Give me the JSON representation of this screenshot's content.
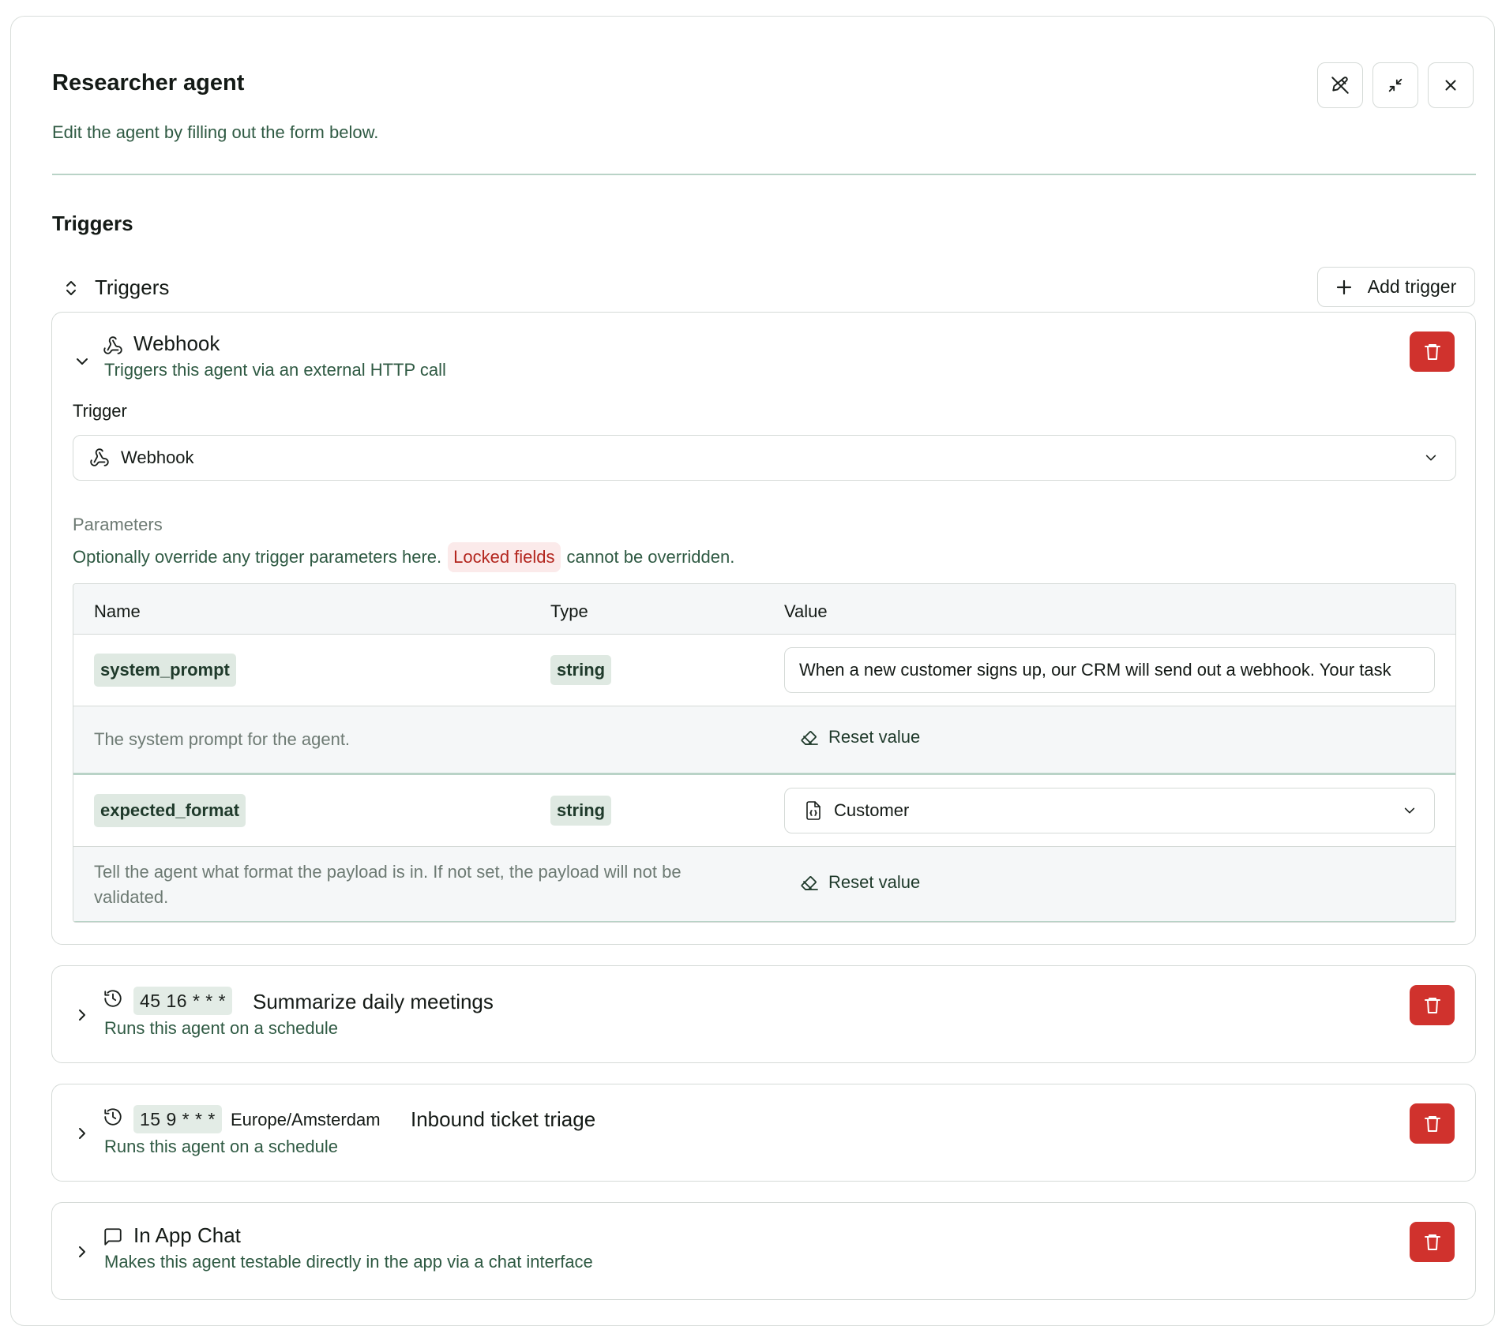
{
  "header": {
    "title": "Researcher agent",
    "subtitle": "Edit the agent by filling out the form below."
  },
  "section": {
    "title": "Triggers"
  },
  "triggers_toolbar": {
    "label": "Triggers",
    "add_label": "Add trigger"
  },
  "webhook_card": {
    "title": "Webhook",
    "description": "Triggers this agent via an external HTTP call",
    "trigger_label": "Trigger",
    "trigger_value": "Webhook",
    "params_label": "Parameters",
    "params_help_prefix": "Optionally override any trigger parameters here.",
    "params_help_locked": "Locked fields",
    "params_help_suffix": "cannot be overridden.",
    "table": {
      "columns": [
        "Name",
        "Type",
        "Value"
      ],
      "rows": [
        {
          "name": "system_prompt",
          "type": "string",
          "value": "When a new customer signs up, our CRM will send out a webhook. Your task",
          "description": "The system prompt for the agent.",
          "reset_label": "Reset value"
        },
        {
          "name": "expected_format",
          "type": "string",
          "value": "Customer",
          "description": "Tell the agent what format the payload is in. If not set, the payload will not be validated.",
          "reset_label": "Reset value"
        }
      ]
    }
  },
  "schedule_cards": [
    {
      "cron": "45 16 * * *",
      "timezone": "",
      "title": "Summarize daily meetings",
      "description": "Runs this agent on a schedule"
    },
    {
      "cron": "15 9 * * *",
      "timezone": "Europe/Amsterdam",
      "title": "Inbound ticket triage",
      "description": "Runs this agent on a schedule"
    }
  ],
  "chat_card": {
    "title": "In App Chat",
    "description": "Makes this agent testable directly in the app via a chat interface"
  },
  "colors": {
    "danger": "#d0322d",
    "accent_text": "#2f5a43",
    "divider": "#b9d3c7"
  },
  "icons": [
    "pencil-off-icon",
    "minimize-icon",
    "close-icon",
    "chevron-up-down-icon",
    "plus-icon",
    "webhook-icon",
    "trash-icon",
    "chevron-down-icon",
    "chevron-right-icon",
    "clock-icon",
    "chat-icon",
    "file-json-icon",
    "eraser-icon"
  ]
}
